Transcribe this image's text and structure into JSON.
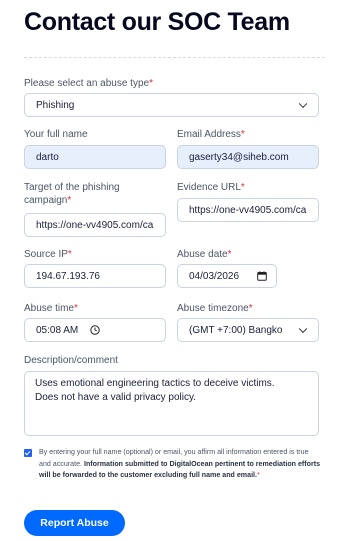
{
  "page": {
    "title": "Contact our SOC Team"
  },
  "form": {
    "abuse_type": {
      "label": "Please select an abuse type",
      "value": "Phishing"
    },
    "full_name": {
      "label": "Your full name",
      "value": "darto"
    },
    "email": {
      "label": "Email Address",
      "value": "gaserty34@siheb.com"
    },
    "target": {
      "label_line1": "Target of the phishing",
      "label_line2": "campaign",
      "value": "https://one-vv4905.com/ca"
    },
    "evidence_url": {
      "label": "Evidence URL",
      "value": "https://one-vv4905.com/ca"
    },
    "source_ip": {
      "label": "Source IP",
      "value": "194.67.193.76"
    },
    "abuse_date": {
      "label": "Abuse date",
      "value": "04/03/2026"
    },
    "abuse_time": {
      "label": "Abuse time",
      "value": "05:08 AM"
    },
    "abuse_timezone": {
      "label": "Abuse timezone",
      "value": "(GMT +7:00) Bangko"
    },
    "description": {
      "label": "Description/comment",
      "value": "Uses emotional engineering tactics to deceive victims.\nDoes not have a valid privacy policy."
    },
    "required_marker": "*"
  },
  "consent": {
    "checked": true,
    "text_plain": "By entering your full name (optional) or email, you affirm all information entered is true and accurate. ",
    "text_bold": "Information submitted to DigitalOcean pertinent to remediation efforts will be forwarded to the customer excluding full name and email."
  },
  "submit": {
    "label": "Report Abuse"
  },
  "colors": {
    "accent": "#0069ff",
    "required": "#e0303a",
    "filled_bg": "#e8effc"
  }
}
